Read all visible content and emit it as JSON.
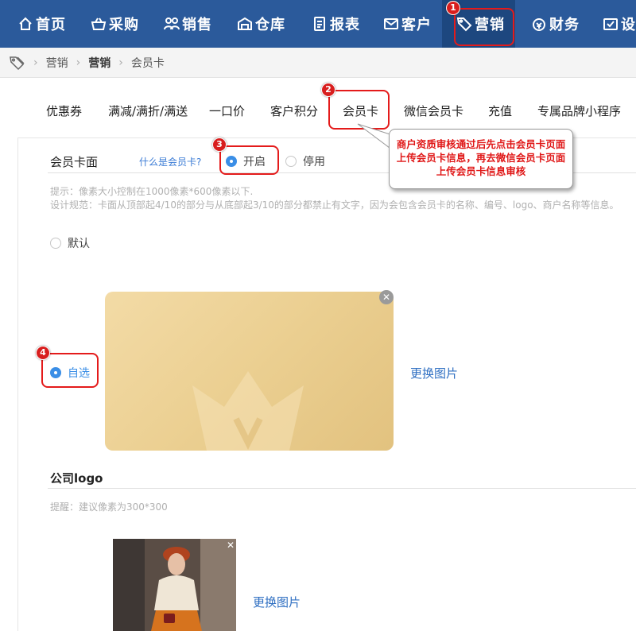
{
  "nav": {
    "items": [
      {
        "label": "首页",
        "icon": "home-icon"
      },
      {
        "label": "采购",
        "icon": "basket-icon"
      },
      {
        "label": "销售",
        "icon": "people-icon"
      },
      {
        "label": "仓库",
        "icon": "warehouse-icon"
      },
      {
        "label": "报表",
        "icon": "report-icon"
      },
      {
        "label": "客户",
        "icon": "mail-icon"
      },
      {
        "label": "营销",
        "icon": "tag-icon",
        "active": true
      },
      {
        "label": "财务",
        "icon": "coin-icon"
      },
      {
        "label": "设",
        "icon": "settings-icon"
      }
    ]
  },
  "breadcrumb": {
    "items": [
      "营销",
      "营销",
      "会员卡"
    ]
  },
  "tabs": [
    "优惠券",
    "满减/满折/满送",
    "一口价",
    "客户积分",
    "会员卡",
    "微信会员卡",
    "充值",
    "专属品牌小程序"
  ],
  "card_face": {
    "title": "会员卡面",
    "what_link": "什么是会员卡?",
    "enable_label": "开启",
    "disable_label": "停用",
    "hint_line1": "提示：像素大小控制在1000像素*600像素以下.",
    "hint_line2": "设计规范：卡面从顶部起4/10的部分与从底部起3/10的部分都禁止有文字，因为会包含会员卡的名称、编号、logo、商户名称等信息。",
    "default_label": "默认",
    "custom_label": "自选",
    "change_image": "更换图片"
  },
  "company_logo": {
    "title": "公司logo",
    "hint": "提醒：建议像素为300*300",
    "change_image": "更换图片"
  },
  "annotations": {
    "badges": [
      "1",
      "2",
      "3",
      "4"
    ],
    "callout": "商户资质审核通过后先点击会员卡页面上传会员卡信息，再去微信会员卡页面上传会员卡信息审核"
  },
  "colors": {
    "nav_bg": "#2b5a9b",
    "nav_active": "#1d477f",
    "annotation_red": "#e41b1b",
    "link_blue": "#2f6fc2"
  }
}
